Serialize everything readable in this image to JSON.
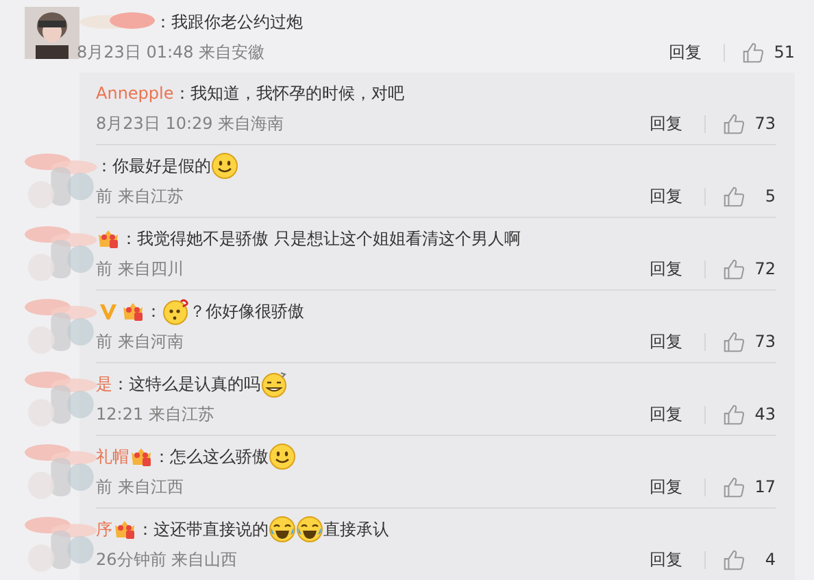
{
  "comment": {
    "text": "：我跟你老公约过炮",
    "meta": "8月23日 01:48 来自安徽",
    "reply": "回复",
    "likes": "51"
  },
  "replies": [
    {
      "name": "Annepple",
      "smudge": false,
      "parts": [
        {
          "kind": "text",
          "text": "：我知道，我怀孕的时候，对吧"
        }
      ],
      "meta": "8月23日 10:29 来自海南",
      "reply": "回复",
      "likes": "73"
    },
    {
      "smudge": true,
      "parts": [
        {
          "kind": "text",
          "text": "：你最好是假的"
        },
        {
          "kind": "smile"
        }
      ],
      "meta": "前 来自江苏",
      "reply": "回复",
      "likes": "5"
    },
    {
      "smudge": true,
      "badges": [
        {
          "kind": "crown"
        }
      ],
      "parts": [
        {
          "kind": "text",
          "text": "：我觉得她不是骄傲 只是想让这个姐姐看清这个男人啊"
        }
      ],
      "meta": "前 来自四川",
      "reply": "回复",
      "likes": "72"
    },
    {
      "smudge": true,
      "badges": [
        {
          "kind": "vip"
        },
        {
          "kind": "crown"
        }
      ],
      "parts": [
        {
          "kind": "text",
          "text": "："
        },
        {
          "kind": "puzzled"
        },
        {
          "kind": "text",
          "text": "？你好像很骄傲"
        }
      ],
      "meta": "前 来自河南",
      "reply": "回复",
      "likes": "73"
    },
    {
      "name": "是",
      "smudge": true,
      "parts": [
        {
          "kind": "text",
          "text": "：这特么是认真的吗"
        },
        {
          "kind": "grin"
        }
      ],
      "meta": "12:21 来自江苏",
      "reply": "回复",
      "likes": "43"
    },
    {
      "name": "礼帽",
      "smudge": true,
      "badges": [
        {
          "kind": "crown"
        }
      ],
      "parts": [
        {
          "kind": "text",
          "text": "：怎么这么骄傲"
        },
        {
          "kind": "smile"
        }
      ],
      "meta": "前 来自江西",
      "reply": "回复",
      "likes": "17"
    },
    {
      "name": "序",
      "smudge": true,
      "badges": [
        {
          "kind": "crown"
        }
      ],
      "parts": [
        {
          "kind": "text",
          "text": "：这还带直接说的"
        },
        {
          "kind": "cry-laugh"
        },
        {
          "kind": "cry-laugh"
        },
        {
          "kind": "text",
          "text": "直接承认"
        }
      ],
      "meta": "26分钟前 来自山西",
      "reply": "回复",
      "likes": "4"
    }
  ]
}
